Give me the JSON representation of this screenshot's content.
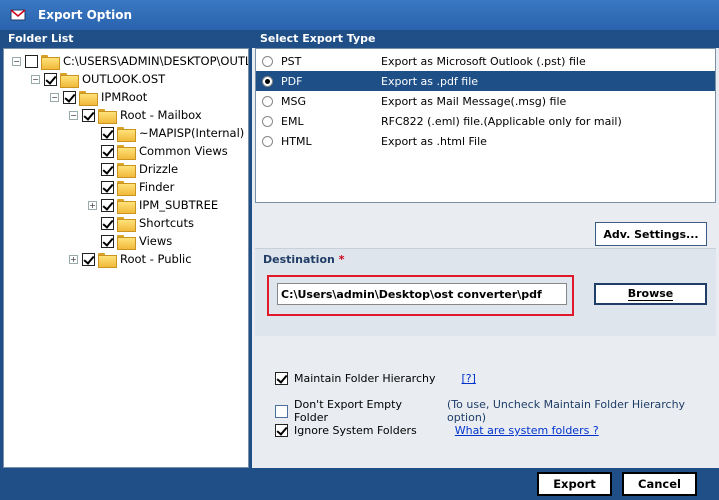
{
  "window": {
    "title": "Export Option"
  },
  "left": {
    "header": "Folder List",
    "tree": [
      {
        "label": "C:\\USERS\\ADMIN\\DESKTOP\\OUTLOOK",
        "checked": false,
        "expander": "-",
        "level": 0
      },
      {
        "label": "OUTLOOK.OST",
        "checked": true,
        "expander": "-",
        "level": 1
      },
      {
        "label": "IPMRoot",
        "checked": true,
        "expander": "-",
        "level": 2
      },
      {
        "label": "Root - Mailbox",
        "checked": true,
        "expander": "-",
        "level": 3
      },
      {
        "label": "~MAPISP(Internal)",
        "checked": true,
        "expander": "",
        "level": 4
      },
      {
        "label": "Common Views",
        "checked": true,
        "expander": "",
        "level": 4
      },
      {
        "label": "Drizzle",
        "checked": true,
        "expander": "",
        "level": 4
      },
      {
        "label": "Finder",
        "checked": true,
        "expander": "",
        "level": 4
      },
      {
        "label": "IPM_SUBTREE",
        "checked": true,
        "expander": "+",
        "level": 4
      },
      {
        "label": "Shortcuts",
        "checked": true,
        "expander": "",
        "level": 4
      },
      {
        "label": "Views",
        "checked": true,
        "expander": "",
        "level": 4
      },
      {
        "label": "Root - Public",
        "checked": true,
        "expander": "+",
        "level": 3
      }
    ]
  },
  "right": {
    "header": "Select Export Type",
    "types": [
      {
        "name": "PST",
        "desc": "Export as Microsoft Outlook (.pst) file",
        "selected": false
      },
      {
        "name": "PDF",
        "desc": "Export as .pdf file",
        "selected": true
      },
      {
        "name": "MSG",
        "desc": "Export as Mail Message(.msg) file",
        "selected": false
      },
      {
        "name": "EML",
        "desc": "RFC822 (.eml) file.(Applicable only for mail)",
        "selected": false
      },
      {
        "name": "HTML",
        "desc": "Export as .html File",
        "selected": false
      }
    ],
    "adv_settings": "Adv. Settings...",
    "destination": {
      "label": "Destination",
      "required": "*",
      "value": "C:\\Users\\admin\\Desktop\\ost converter\\pdf",
      "browse": "Browse"
    },
    "options": {
      "maintain_hierarchy": "Maintain Folder Hierarchy",
      "maintain_help": "[?]",
      "dont_export_empty": "Don't Export Empty Folder",
      "dont_export_hint": "(To use, Uncheck Maintain Folder Hierarchy option)",
      "ignore_system": "Ignore System Folders",
      "system_link": "What are system folders ?"
    }
  },
  "footer": {
    "export": "Export",
    "cancel": "Cancel"
  },
  "colors": {
    "accent": "#1f4f86",
    "selected_row": "#1e4f87",
    "highlight_border": "#e0182b"
  }
}
